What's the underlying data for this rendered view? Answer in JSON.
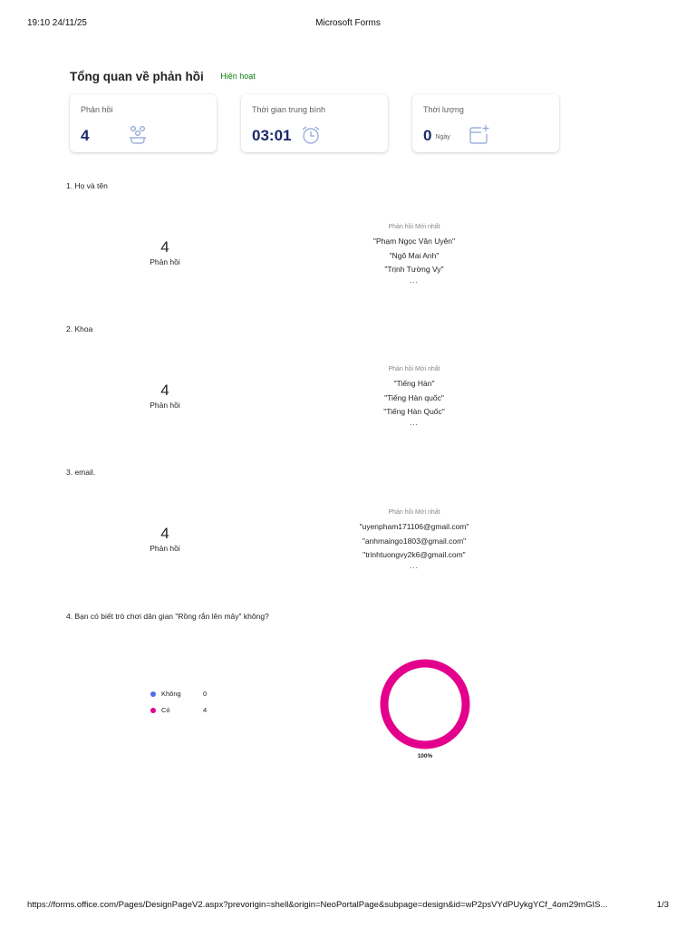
{
  "print_header": {
    "timestamp": "19:10 24/11/25",
    "title": "Microsoft Forms"
  },
  "overview": {
    "title": "Tổng quan về phản hồi",
    "status": "Hiện hoạt",
    "cards": [
      {
        "label": "Phản hồi",
        "value": "4",
        "icon": "responses-icon"
      },
      {
        "label": "Thời gian trung bình",
        "value": "03:01",
        "icon": "alarm-clock-icon"
      },
      {
        "label": "Thời lượng",
        "value": "0",
        "unit": "Ngày",
        "icon": "calendar-add-icon"
      }
    ]
  },
  "questions": [
    {
      "title": "1. Họ và tên",
      "count": "4",
      "count_label": "Phản hồi",
      "latest_header": "Phản hồi Mới nhất",
      "answers": [
        "\"Phạm Ngọc Vân Uyên\"",
        "\"Ngô Mai Anh\"",
        "\"Trịnh Tường Vy\""
      ],
      "more": "..."
    },
    {
      "title": "2. Khoa",
      "count": "4",
      "count_label": "Phản hồi",
      "latest_header": "Phản hồi Mới nhất",
      "answers": [
        "\"Tiếng Hàn\"",
        "\"Tiếng Hàn quốc\"",
        "\"Tiếng Hàn Quốc\""
      ],
      "more": "..."
    },
    {
      "title": "3. email.",
      "count": "4",
      "count_label": "Phản hồi",
      "latest_header": "Phản hồi Mới nhất",
      "answers": [
        "\"uyenpham171106@gmail.com\"",
        "\"anhmaingo1803@gmail.com\"",
        "\"trinhtuongvy2k6@gmail.com\""
      ],
      "more": "..."
    },
    {
      "title": "4. Bạn có biết trò chơi dân gian \"Rồng rắn lên mây\" không?"
    }
  ],
  "chart_data": {
    "type": "pie",
    "donut": true,
    "categories": [
      "Không",
      "Có"
    ],
    "values": [
      0,
      4
    ],
    "colors": [
      "#4f6bed",
      "#e3008c"
    ],
    "data_labels": [
      "",
      "100%"
    ],
    "legend": "left"
  },
  "print_footer": {
    "url": "https://forms.office.com/Pages/DesignPageV2.aspx?prevorigin=shell&origin=NeoPortalPage&subpage=design&id=wP2psVYdPUykgYCf_4om29mGIS...",
    "page": "1/3"
  },
  "colors": {
    "accent": "#1b2a6b",
    "status_green": "#107c10",
    "donut_pink": "#e3008c",
    "donut_blue": "#4f6bed"
  }
}
